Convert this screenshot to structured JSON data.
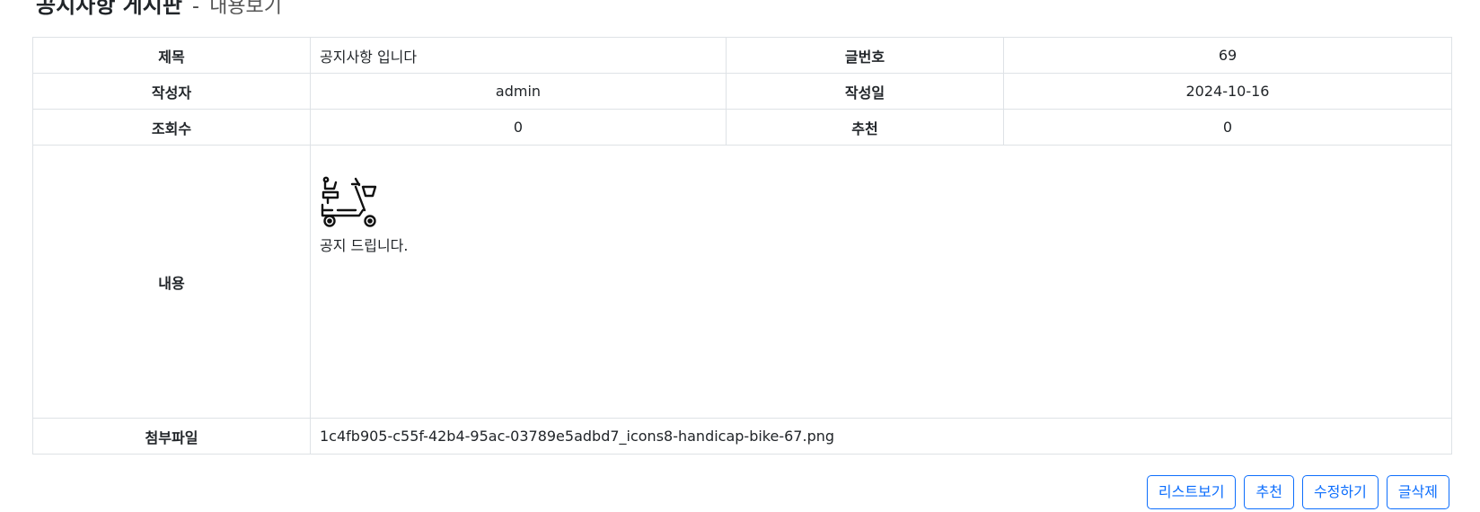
{
  "header": {
    "title": "공지사항 게시판",
    "separator": "-",
    "subtitle": "내용보기"
  },
  "post": {
    "labels": {
      "title": "제목",
      "number": "글번호",
      "author": "작성자",
      "date": "작성일",
      "views": "조회수",
      "recommend": "추천",
      "content": "내용",
      "attachment": "첨부파일"
    },
    "title": "공지사항 입니다",
    "number": "69",
    "author": "admin",
    "date": "2024-10-16",
    "views": "0",
    "recommend": "0",
    "content_image_icon": "handicap-bike-icon",
    "content_text": "공지 드립니다.",
    "attachment": "1c4fb905-c55f-42b4-95ac-03789e5adbd7_icons8-handicap-bike-67.png"
  },
  "actions": {
    "list_label": "리스트보기",
    "recommend_label": "추천",
    "edit_label": "수정하기",
    "delete_label": "글삭제",
    "accent_color": "#0d6efd"
  }
}
